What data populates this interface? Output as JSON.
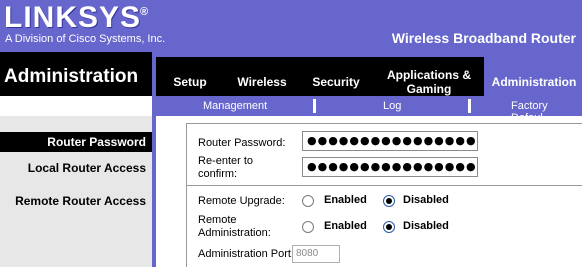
{
  "brand": {
    "logo": "LINKSYS",
    "registered": "®",
    "tagline": "A Division of Cisco Systems, Inc.",
    "product": "Wireless Broadband Router"
  },
  "section_title": "Administration",
  "tabs": [
    {
      "label": "Setup"
    },
    {
      "label": "Wireless"
    },
    {
      "label": "Security"
    },
    {
      "label_line1": "Applications &",
      "label_line2": "Gaming"
    },
    {
      "label": "Administration"
    }
  ],
  "subtabs": [
    "Management",
    "Log",
    "Factory Defaul"
  ],
  "left": {
    "router_password": "Router Password",
    "local_access": "Local Router Access",
    "remote_access": "Remote Router Access"
  },
  "form": {
    "router_password_label": "Router Password:",
    "router_password_value": "●●●●●●●●●●●●●●●●",
    "reenter_line1": "Re-enter to",
    "reenter_line2": "confirm:",
    "reenter_value": "●●●●●●●●●●●●●●●●",
    "remote_upgrade_label": "Remote Upgrade:",
    "remote_admin_line1": "Remote",
    "remote_admin_line2": "Administration:",
    "enabled": "Enabled",
    "disabled": "Disabled",
    "admin_port_label": "Administration Port:",
    "admin_port_value": "8080"
  }
}
